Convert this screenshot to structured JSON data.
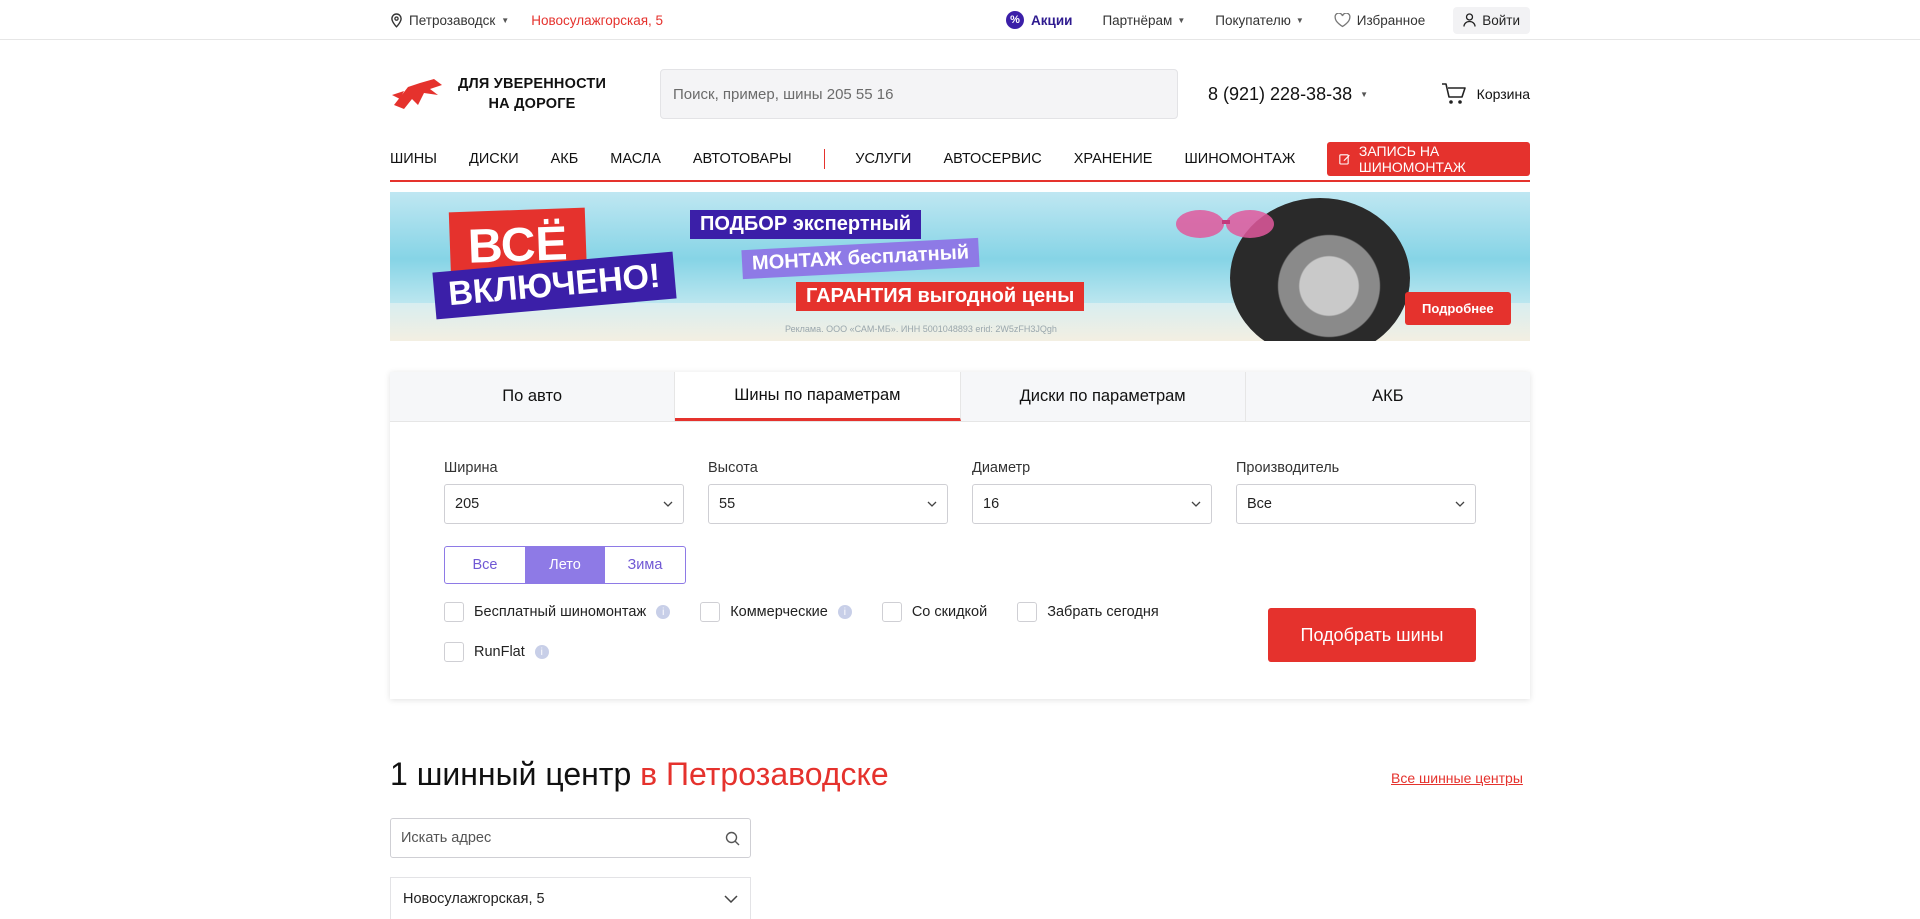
{
  "topbar": {
    "city": "Петрозаводск",
    "address": "Новосулажгорская, 5",
    "promo": "Акции",
    "partners": "Партнёрам",
    "buyers": "Покупателю",
    "favorites": "Избранное",
    "login": "Войти"
  },
  "header": {
    "logo_line1": "ДЛЯ УВЕРЕННОСТИ",
    "logo_line2": "НА ДОРОГЕ",
    "search_placeholder": "Поиск, пример, шины 205 55 16",
    "phone": "8 (921) 228-38-38",
    "cart": "Корзина"
  },
  "nav": {
    "items": [
      "ШИНЫ",
      "ДИСКИ",
      "АКБ",
      "МАСЛА",
      "АВТОТОВАРЫ"
    ],
    "items2": [
      "УСЛУГИ",
      "АВТОСЕРВИС",
      "ХРАНЕНИЕ",
      "ШИНОМОНТАЖ"
    ],
    "cta": "ЗАПИСЬ НА ШИНОМОНТАЖ"
  },
  "banner": {
    "vse": "ВСЁ",
    "vkl": "ВКЛЮЧЕНО!",
    "line1": "ПОДБОР экспертный",
    "line2": "МОНТАЖ бесплатный",
    "line3": "ГАРАНТИЯ выгодной цены",
    "ad": "Реклама. ООО «САМ-МБ». ИНН 5001048893 erid: 2W5zFH3JQgh",
    "more": "Подробнее"
  },
  "tabs": [
    "По авто",
    "Шины по параметрам",
    "Диски по параметрам",
    "АКБ"
  ],
  "filters": {
    "width_label": "Ширина",
    "width_value": "205",
    "height_label": "Высота",
    "height_value": "55",
    "diameter_label": "Диаметр",
    "diameter_value": "16",
    "maker_label": "Производитель",
    "maker_value": "Все"
  },
  "season": [
    "Все",
    "Лето",
    "Зима"
  ],
  "checkboxes": {
    "free_mount": "Бесплатный шиномонтаж",
    "commercial": "Коммерческие",
    "discount": "Со скидкой",
    "today": "Забрать сегодня",
    "runflat": "RunFlat"
  },
  "submit": "Подобрать шины",
  "centers": {
    "title_black": "1 шинный центр",
    "title_red": "в Петрозаводске",
    "all_link": "Все шинные центры",
    "search_placeholder": "Искать адрес",
    "item": "Новосулажгорская, 5"
  },
  "colors": {
    "accent": "#e5322d",
    "purple": "#3b1fa8",
    "lavender": "#8e7ae6"
  }
}
